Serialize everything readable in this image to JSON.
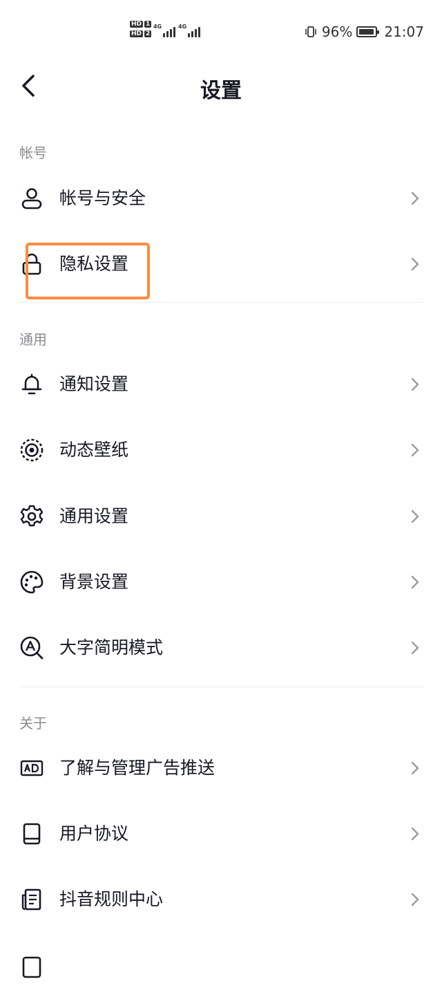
{
  "status_bar": {
    "sim1": {
      "hd": "HD",
      "num": "1"
    },
    "sim2": {
      "hd": "HD",
      "num": "2"
    },
    "network1": "4G",
    "network2": "4G",
    "battery_text": "96%",
    "battery_level": 0.96,
    "time": "21:07"
  },
  "nav": {
    "title": "设置"
  },
  "sections": {
    "account": {
      "header": "帐号"
    },
    "general": {
      "header": "通用"
    },
    "about": {
      "header": "关于"
    }
  },
  "items": {
    "account_security": {
      "label": "帐号与安全",
      "icon": "user-icon"
    },
    "privacy": {
      "label": "隐私设置",
      "icon": "lock-icon"
    },
    "notifications": {
      "label": "通知设置",
      "icon": "bell-icon"
    },
    "live_wallpaper": {
      "label": "动态壁纸",
      "icon": "wallpaper-icon"
    },
    "general_settings": {
      "label": "通用设置",
      "icon": "gear-icon"
    },
    "background": {
      "label": "背景设置",
      "icon": "palette-icon"
    },
    "large_font": {
      "label": "大字简明模式",
      "icon": "large-font-icon"
    },
    "ads": {
      "label": "了解与管理广告推送",
      "icon": "ad-icon"
    },
    "user_agreement": {
      "label": "用户协议",
      "icon": "book-icon"
    },
    "rules_center": {
      "label": "抖音规则中心",
      "icon": "document-icon"
    }
  },
  "colors": {
    "highlight": "#ff8a3d",
    "text": "#161823",
    "section_header": "#8a8b91",
    "chevron": "#9a9ba0"
  }
}
